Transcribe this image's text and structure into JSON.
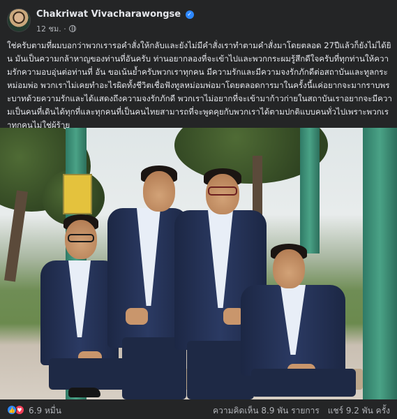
{
  "post": {
    "author_name": "Chakriwat Vivacharawongse",
    "timestamp": "12 ชม.",
    "visibility_icon": "globe-icon",
    "verified_icon": "verified-badge-icon",
    "text": "ใช่ครับตามที่ผมบอกว่าพวกเรารอคำสั่งให้กลับและยังไม่มีคำสั่งเราทำตามคำสั่งมาโดยตลอด 27ปีแล้วก็ยังไม่ได้ยิน มันเป็นความกล้าหาญของท่านที่อันครับ ท่านอยากลองที่จะเข้าไปและพวกกระผมรู้สึกดีใจครับที่ทุกท่านให้ความรักความอบอุ่นต่อท่านที่ อัน ขอเน้นย้ำครับพวกเราทุกคน มีความรักและมีความจงรักภักดีต่อสถาบันและทูลกระหม่อมพ่อ พวกเราไม่เคยทำอะไรผิดทั้งชีวิตเชื่อฟังทูลหม่อมพ่อมาโดยตลอดการมาในครั้งนี้แค่อยากจะมากราบพระบาทด้วยความรักและได้แสดงถึงความจงรักภักดี พวกเราไม่อยากที่จะเข้ามาก้าวก่ายในสถาบันเราอยากจะมีความเป็นคนที่เดินได้ทุกที่และทุกคนที่เป็นคนไทยสามารถที่จะพูดคุยกับพวกเราได้ตามปกติแบบคนทั่วไปเพราะพวกเราทุกคนไม่ใช่ผู้ร้าย"
  },
  "footer": {
    "like_icon": "like-icon",
    "love_icon": "love-icon",
    "reactions_count": "6.9 หมื่น",
    "comments": "ความคิดเห็น 8.9 พัน รายการ",
    "shares": "แชร์ 9.2 พัน ครั้ง"
  },
  "colors": {
    "background": "#242526",
    "text_primary": "#e4e6eb",
    "text_secondary": "#b0b3b8",
    "verified": "#2d88ff",
    "love": "#f33e58"
  }
}
